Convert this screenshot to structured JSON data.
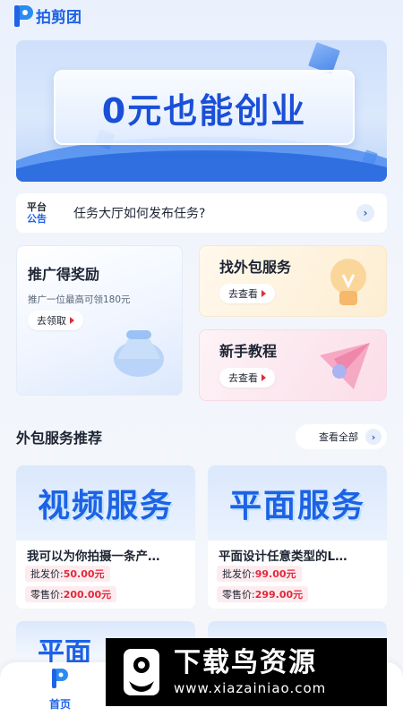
{
  "app": {
    "logo_text": "拍剪团"
  },
  "banner": {
    "title": "0元也能创业"
  },
  "notice": {
    "tag_line1": "平台",
    "tag_line2": "公告",
    "text": "任务大厅如何发布任务?"
  },
  "promo": {
    "title": "推广得奖励",
    "subtitle": "推广一位最高可领180元",
    "button": "去领取"
  },
  "outsource": {
    "title": "找外包服务",
    "button": "去查看"
  },
  "tutorial": {
    "title": "新手教程",
    "button": "去查看"
  },
  "section": {
    "title": "外包服务推荐",
    "view_all": "查看全部"
  },
  "services": [
    {
      "image_text": "视频服务",
      "name": "我可以为你拍摄一条产…",
      "wholesale_label": "批发价:",
      "wholesale_price": "50.00元",
      "retail_label": "零售价:",
      "retail_price": "200.00元"
    },
    {
      "image_text": "平面服务",
      "name": "平面设计任意类型的L…",
      "wholesale_label": "批发价:",
      "wholesale_price": "99.00元",
      "retail_label": "零售价:",
      "retail_price": "299.00元"
    }
  ],
  "peek": {
    "text": "平面"
  },
  "tabbar": {
    "home": "首页"
  },
  "watermark": {
    "title": "下载鸟资源",
    "url": "www.xiazainiao.com"
  },
  "colors": {
    "brand": "#1f63e6",
    "price_red": "#e02a3c"
  }
}
